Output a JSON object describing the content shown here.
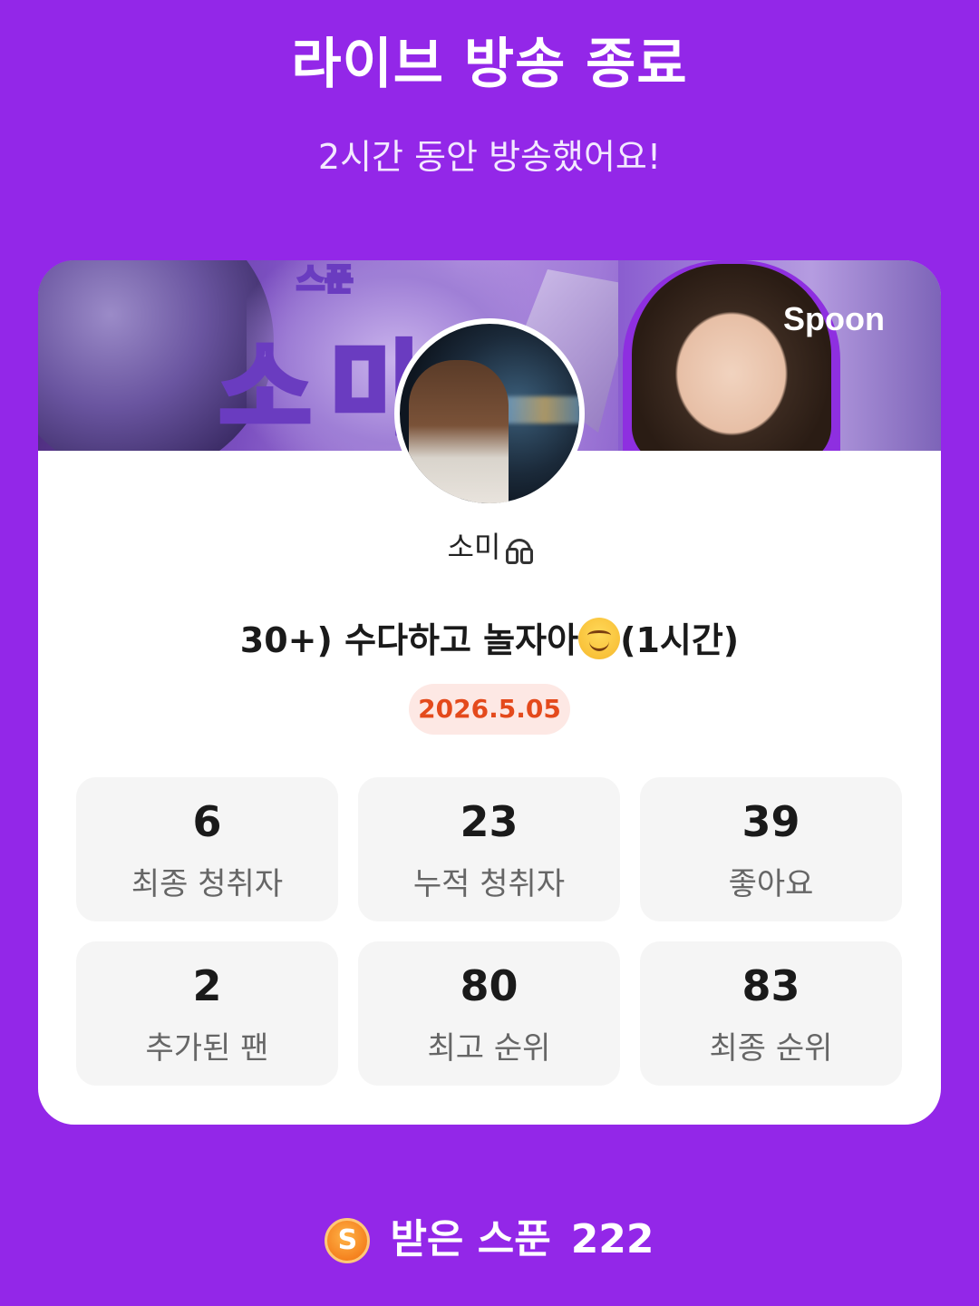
{
  "header": {
    "title": "라이브 방송 종료",
    "subtitle": "2시간 동안 방송했어요!"
  },
  "banner": {
    "text_large": "소미",
    "text_small": "스푼",
    "logo": "Spoon"
  },
  "profile": {
    "username": "소미",
    "username_icon": "headphone-icon"
  },
  "live": {
    "title_before_emoji": "30+) 수다하고 놀자아",
    "emoji_icon": "smiling-face-icon",
    "title_after_emoji": "(1시간)",
    "date": "2026.5.05"
  },
  "stats": [
    {
      "value": "6",
      "label": "최종 청취자"
    },
    {
      "value": "23",
      "label": "누적 청취자"
    },
    {
      "value": "39",
      "label": "좋아요"
    },
    {
      "value": "2",
      "label": "추가된 팬"
    },
    {
      "value": "80",
      "label": "최고 순위"
    },
    {
      "value": "83",
      "label": "최종 순위"
    }
  ],
  "spoons": {
    "coin_letter": "S",
    "label": "받은 스푼",
    "count": "222"
  },
  "colors": {
    "background": "#9327e8",
    "date_badge_text": "#e44a1c",
    "date_badge_bg": "#fde8e4",
    "coin": "#f5821f"
  }
}
